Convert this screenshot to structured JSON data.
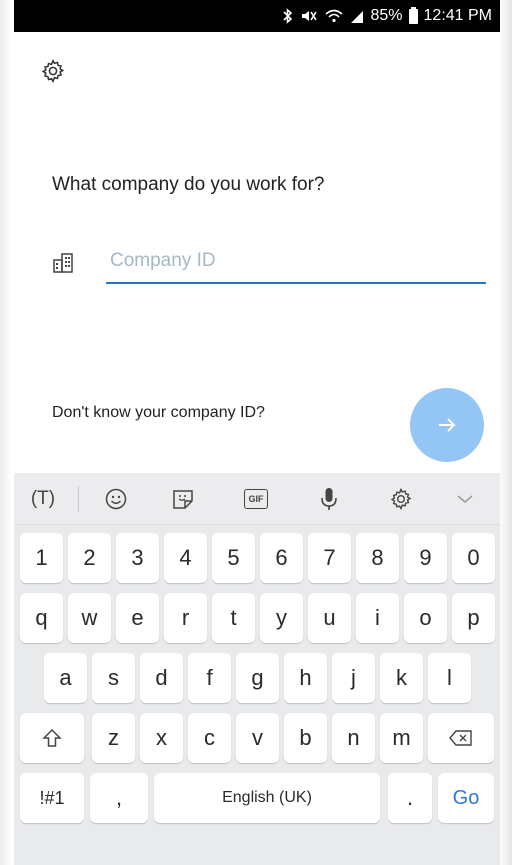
{
  "status_bar": {
    "battery": "85%",
    "time": "12:41 PM",
    "icons": [
      "bluetooth-icon",
      "mute-icon",
      "wifi-icon",
      "signal-icon",
      "battery-icon"
    ]
  },
  "app": {
    "settings_icon": "gear-icon",
    "question": "What company do you work for?",
    "company_icon": "building-icon",
    "company_placeholder": "Company ID",
    "company_value": "",
    "help_link": "Don't know your company ID?",
    "next_icon": "arrow-right-icon"
  },
  "keyboard": {
    "toolbar": [
      {
        "name": "text-mode-icon",
        "glyph": "(T)"
      },
      {
        "name": "emoji-icon"
      },
      {
        "name": "sticker-icon"
      },
      {
        "name": "gif-icon",
        "glyph": "GIF"
      },
      {
        "name": "microphone-icon"
      },
      {
        "name": "keyboard-settings-icon"
      },
      {
        "name": "collapse-chevron-icon"
      }
    ],
    "row_numbers": [
      "1",
      "2",
      "3",
      "4",
      "5",
      "6",
      "7",
      "8",
      "9",
      "0"
    ],
    "row_1": [
      "q",
      "w",
      "e",
      "r",
      "t",
      "y",
      "u",
      "i",
      "o",
      "p"
    ],
    "row_2": [
      "a",
      "s",
      "d",
      "f",
      "g",
      "h",
      "j",
      "k",
      "l"
    ],
    "row_3": [
      "z",
      "x",
      "c",
      "v",
      "b",
      "n",
      "m"
    ],
    "symbols_key": "!#1",
    "comma_key": ",",
    "space_key": "English (UK)",
    "period_key": ".",
    "go_key": "Go",
    "accent_color": "#2b7bd6"
  },
  "colors": {
    "input_underline": "#1f78c8",
    "next_button": "#93c5f5",
    "placeholder": "#a6b7c6",
    "keyboard_bg": "#e9eaec"
  }
}
